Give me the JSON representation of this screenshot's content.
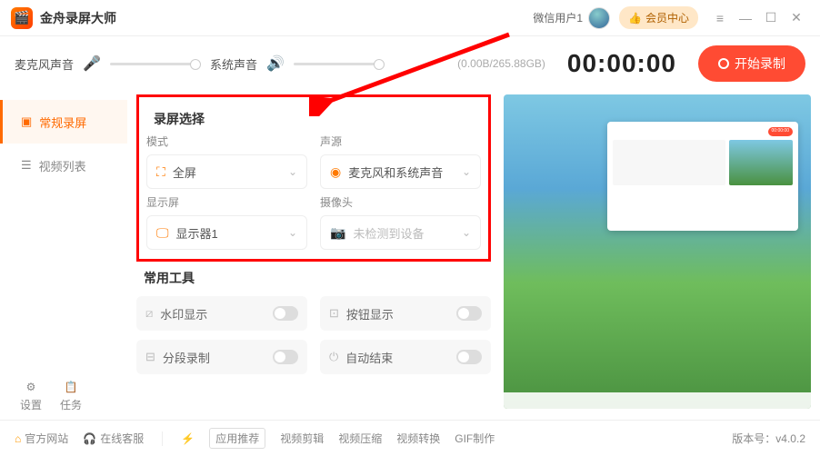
{
  "titlebar": {
    "app_name": "金舟录屏大师",
    "user_name": "微信用户1",
    "vip_label": "会员中心"
  },
  "topbar": {
    "mic_label": "麦克风声音",
    "sys_label": "系统声音",
    "storage": "(0.00B/265.88GB)",
    "timer": "00:00:00",
    "record_label": "开始录制"
  },
  "sidebar": {
    "items": [
      {
        "label": "常规录屏",
        "active": true
      },
      {
        "label": "视频列表",
        "active": false
      }
    ],
    "settings_label": "设置",
    "tasks_label": "任务"
  },
  "panel": {
    "section1_title": "录屏选择",
    "mode_label": "模式",
    "mode_value": "全屏",
    "source_label": "声源",
    "source_value": "麦克风和系统声音",
    "display_label": "显示屏",
    "display_value": "显示器1",
    "camera_label": "摄像头",
    "camera_value": "未检测到设备",
    "section2_title": "常用工具",
    "tools": [
      {
        "label": "水印显示"
      },
      {
        "label": "按钮显示"
      },
      {
        "label": "分段录制"
      },
      {
        "label": "自动结束"
      }
    ]
  },
  "footer": {
    "official": "官方网站",
    "service": "在线客服",
    "recommend": "应用推荐",
    "links": [
      "视频剪辑",
      "视频压缩",
      "视频转换",
      "GIF制作"
    ],
    "version_label": "版本号：",
    "version": "v4.0.2"
  }
}
